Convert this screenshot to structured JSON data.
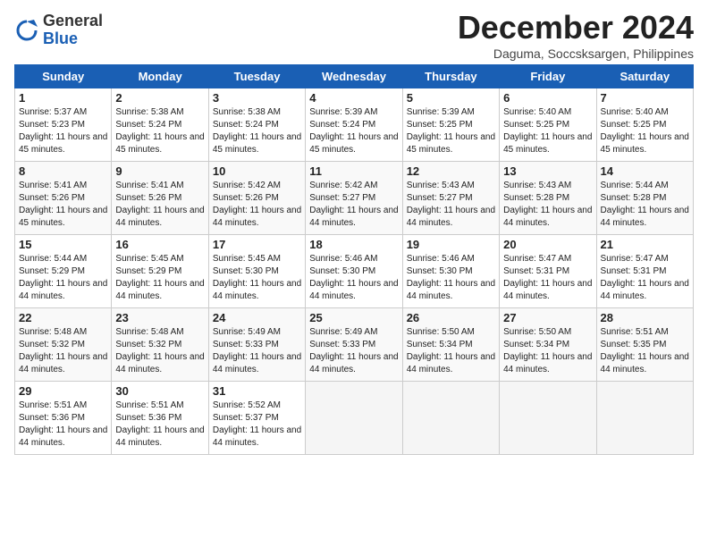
{
  "header": {
    "logo_general": "General",
    "logo_blue": "Blue",
    "month_title": "December 2024",
    "location": "Daguma, Soccsksargen, Philippines"
  },
  "days_of_week": [
    "Sunday",
    "Monday",
    "Tuesday",
    "Wednesday",
    "Thursday",
    "Friday",
    "Saturday"
  ],
  "weeks": [
    [
      {
        "day": 1,
        "sunrise": "5:37 AM",
        "sunset": "5:23 PM",
        "daylight": "11 hours and 45 minutes."
      },
      {
        "day": 2,
        "sunrise": "5:38 AM",
        "sunset": "5:24 PM",
        "daylight": "11 hours and 45 minutes."
      },
      {
        "day": 3,
        "sunrise": "5:38 AM",
        "sunset": "5:24 PM",
        "daylight": "11 hours and 45 minutes."
      },
      {
        "day": 4,
        "sunrise": "5:39 AM",
        "sunset": "5:24 PM",
        "daylight": "11 hours and 45 minutes."
      },
      {
        "day": 5,
        "sunrise": "5:39 AM",
        "sunset": "5:25 PM",
        "daylight": "11 hours and 45 minutes."
      },
      {
        "day": 6,
        "sunrise": "5:40 AM",
        "sunset": "5:25 PM",
        "daylight": "11 hours and 45 minutes."
      },
      {
        "day": 7,
        "sunrise": "5:40 AM",
        "sunset": "5:25 PM",
        "daylight": "11 hours and 45 minutes."
      }
    ],
    [
      {
        "day": 8,
        "sunrise": "5:41 AM",
        "sunset": "5:26 PM",
        "daylight": "11 hours and 45 minutes."
      },
      {
        "day": 9,
        "sunrise": "5:41 AM",
        "sunset": "5:26 PM",
        "daylight": "11 hours and 44 minutes."
      },
      {
        "day": 10,
        "sunrise": "5:42 AM",
        "sunset": "5:26 PM",
        "daylight": "11 hours and 44 minutes."
      },
      {
        "day": 11,
        "sunrise": "5:42 AM",
        "sunset": "5:27 PM",
        "daylight": "11 hours and 44 minutes."
      },
      {
        "day": 12,
        "sunrise": "5:43 AM",
        "sunset": "5:27 PM",
        "daylight": "11 hours and 44 minutes."
      },
      {
        "day": 13,
        "sunrise": "5:43 AM",
        "sunset": "5:28 PM",
        "daylight": "11 hours and 44 minutes."
      },
      {
        "day": 14,
        "sunrise": "5:44 AM",
        "sunset": "5:28 PM",
        "daylight": "11 hours and 44 minutes."
      }
    ],
    [
      {
        "day": 15,
        "sunrise": "5:44 AM",
        "sunset": "5:29 PM",
        "daylight": "11 hours and 44 minutes."
      },
      {
        "day": 16,
        "sunrise": "5:45 AM",
        "sunset": "5:29 PM",
        "daylight": "11 hours and 44 minutes."
      },
      {
        "day": 17,
        "sunrise": "5:45 AM",
        "sunset": "5:30 PM",
        "daylight": "11 hours and 44 minutes."
      },
      {
        "day": 18,
        "sunrise": "5:46 AM",
        "sunset": "5:30 PM",
        "daylight": "11 hours and 44 minutes."
      },
      {
        "day": 19,
        "sunrise": "5:46 AM",
        "sunset": "5:30 PM",
        "daylight": "11 hours and 44 minutes."
      },
      {
        "day": 20,
        "sunrise": "5:47 AM",
        "sunset": "5:31 PM",
        "daylight": "11 hours and 44 minutes."
      },
      {
        "day": 21,
        "sunrise": "5:47 AM",
        "sunset": "5:31 PM",
        "daylight": "11 hours and 44 minutes."
      }
    ],
    [
      {
        "day": 22,
        "sunrise": "5:48 AM",
        "sunset": "5:32 PM",
        "daylight": "11 hours and 44 minutes."
      },
      {
        "day": 23,
        "sunrise": "5:48 AM",
        "sunset": "5:32 PM",
        "daylight": "11 hours and 44 minutes."
      },
      {
        "day": 24,
        "sunrise": "5:49 AM",
        "sunset": "5:33 PM",
        "daylight": "11 hours and 44 minutes."
      },
      {
        "day": 25,
        "sunrise": "5:49 AM",
        "sunset": "5:33 PM",
        "daylight": "11 hours and 44 minutes."
      },
      {
        "day": 26,
        "sunrise": "5:50 AM",
        "sunset": "5:34 PM",
        "daylight": "11 hours and 44 minutes."
      },
      {
        "day": 27,
        "sunrise": "5:50 AM",
        "sunset": "5:34 PM",
        "daylight": "11 hours and 44 minutes."
      },
      {
        "day": 28,
        "sunrise": "5:51 AM",
        "sunset": "5:35 PM",
        "daylight": "11 hours and 44 minutes."
      }
    ],
    [
      {
        "day": 29,
        "sunrise": "5:51 AM",
        "sunset": "5:36 PM",
        "daylight": "11 hours and 44 minutes."
      },
      {
        "day": 30,
        "sunrise": "5:51 AM",
        "sunset": "5:36 PM",
        "daylight": "11 hours and 44 minutes."
      },
      {
        "day": 31,
        "sunrise": "5:52 AM",
        "sunset": "5:37 PM",
        "daylight": "11 hours and 44 minutes."
      },
      null,
      null,
      null,
      null
    ]
  ],
  "labels": {
    "sunrise": "Sunrise: ",
    "sunset": "Sunset: ",
    "daylight": "Daylight: "
  }
}
